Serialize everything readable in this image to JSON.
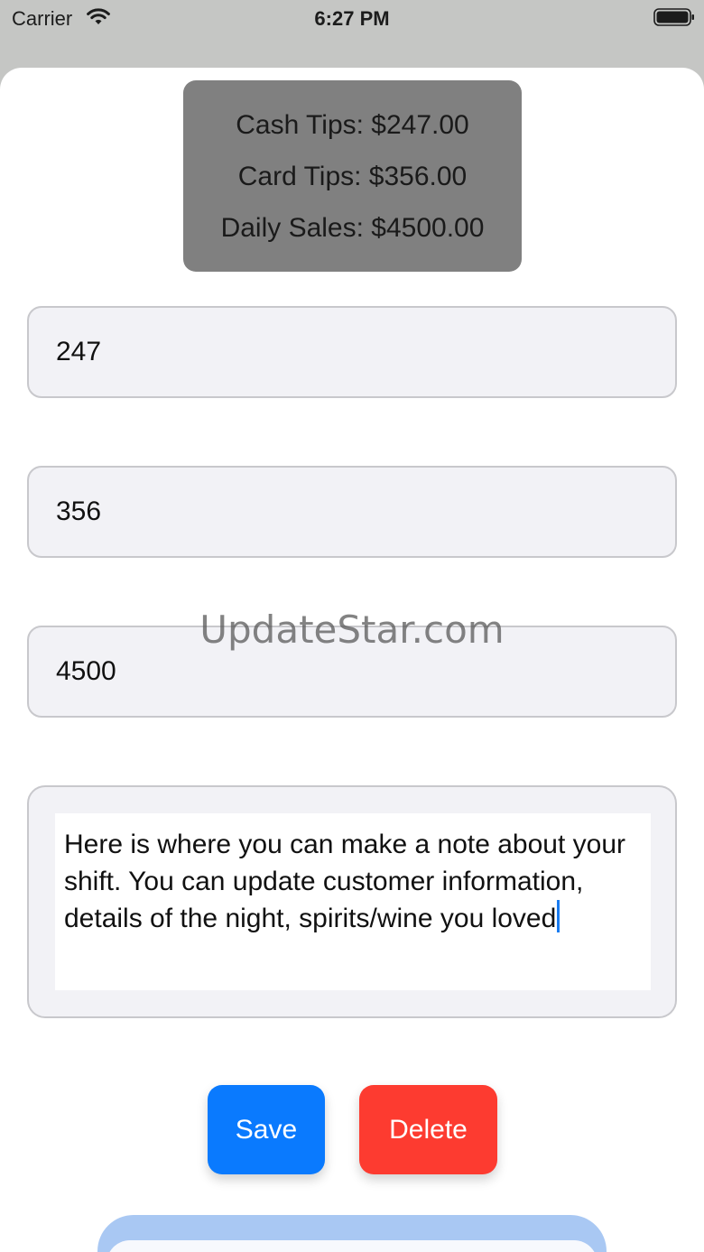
{
  "status_bar": {
    "carrier": "Carrier",
    "time": "6:27 PM"
  },
  "summary": {
    "cash_tips": "Cash Tips: $247.00",
    "card_tips": "Card Tips: $356.00",
    "daily_sales": "Daily Sales: $4500.00"
  },
  "fields": {
    "cash_value": "247",
    "card_value": "356",
    "sales_value": "4500"
  },
  "watermark": "UpdateStar.com",
  "note": {
    "text": "Here is where you can make a note about your shift. You can update customer information, details of the night, spirits/wine you loved"
  },
  "buttons": {
    "save": "Save",
    "delete": "Delete"
  },
  "colors": {
    "save": "#0a7afe",
    "delete": "#fd3b30",
    "summary_bg": "#808080"
  },
  "icons": [
    "wifi-icon",
    "battery-icon"
  ]
}
